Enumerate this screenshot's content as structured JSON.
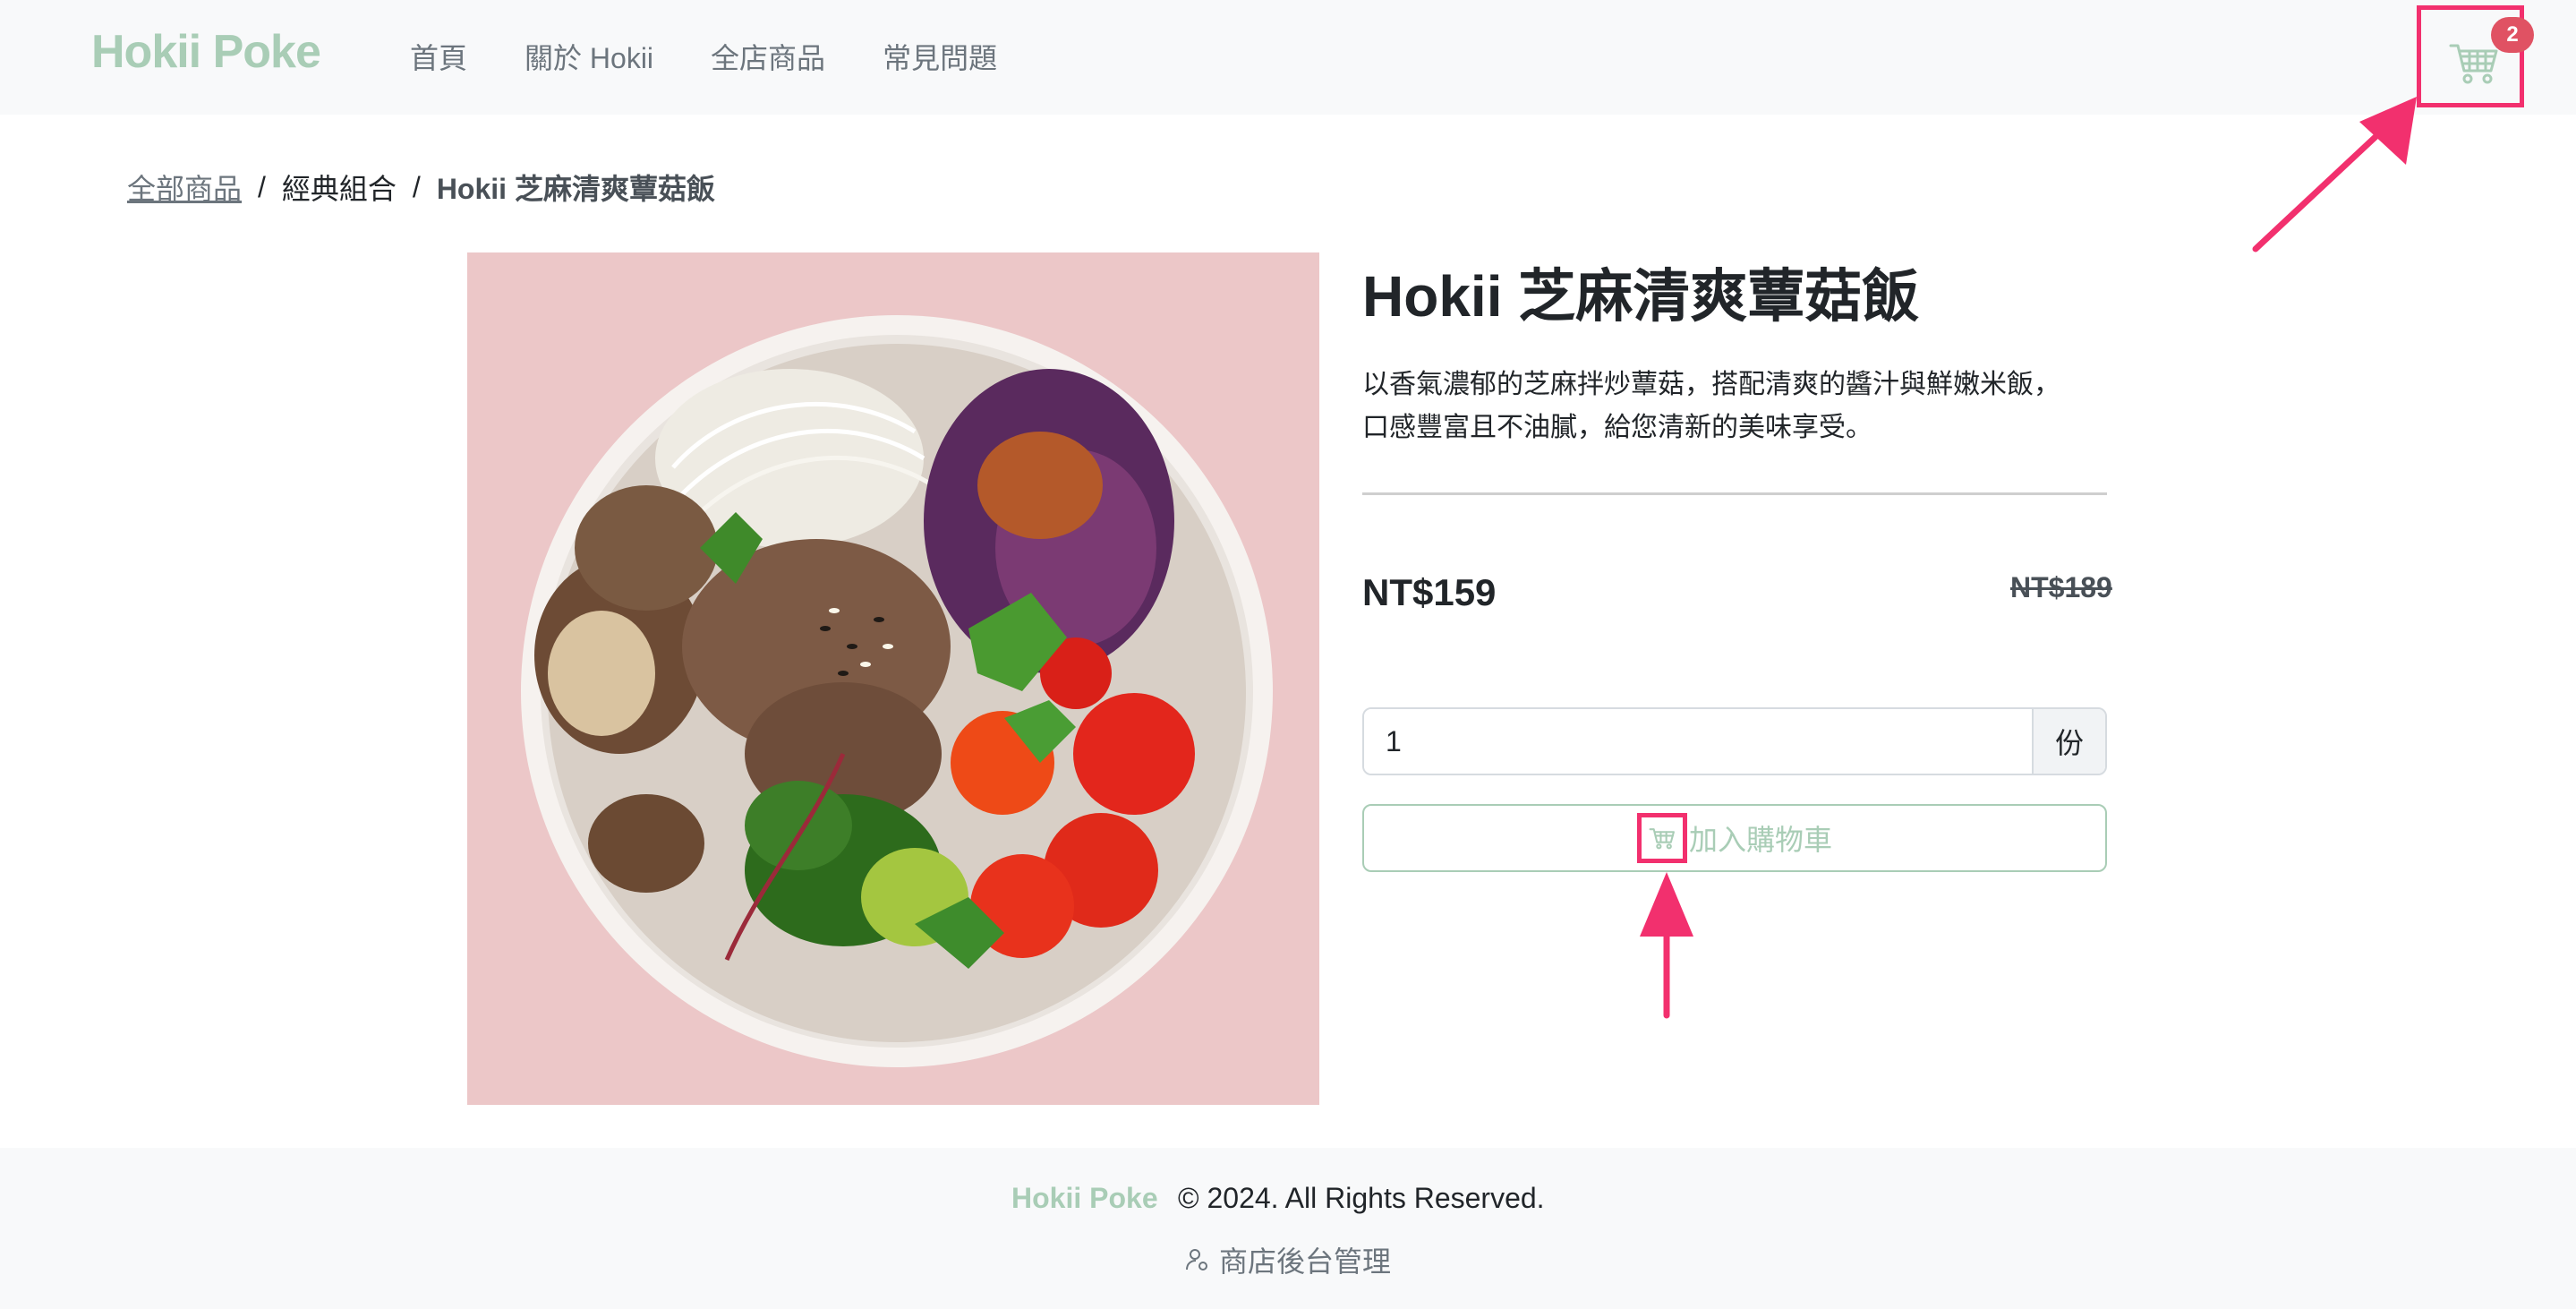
{
  "navbar": {
    "brand": "Hokii Poke",
    "links": [
      "首頁",
      "關於 Hokii",
      "全店商品",
      "常見問題"
    ],
    "cart_count": "2",
    "cart_icon": "cart-icon"
  },
  "breadcrumb": {
    "items": [
      "全部商品",
      "經典組合",
      "Hokii 芝麻清爽蕈菇飯"
    ],
    "separator": "/"
  },
  "product": {
    "title": "Hokii 芝麻清爽蕈菇飯",
    "description_line1": "以香氣濃郁的芝麻拌炒蕈菇，搭配清爽的醬汁與鮮嫩米飯，",
    "description_line2": "口感豐富且不油膩，給您清新的美味享受。",
    "price": "NT$159",
    "original_price": "NT$189",
    "quantity_value": "1",
    "quantity_unit": "份",
    "add_to_cart_label": "加入購物車"
  },
  "footer": {
    "brand": "Hokii Poke",
    "copyright": "© 2024. All Rights Reserved.",
    "admin_label": "商店後台管理",
    "admin_icon": "user-gear-icon"
  },
  "colors": {
    "brand": "#a9cdb6",
    "highlight": "#f2306e",
    "badge": "#e05263",
    "navbar_bg": "#f8f9fa",
    "image_bg": "#ecc7c8"
  }
}
